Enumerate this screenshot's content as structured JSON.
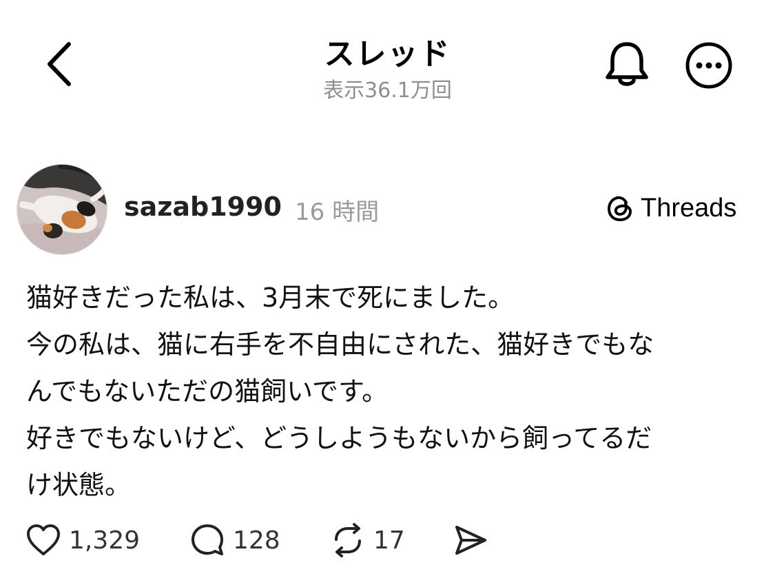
{
  "header": {
    "title": "スレッド",
    "views": "表示36.1万回"
  },
  "post": {
    "username": "sazab1990",
    "time": "16 時間",
    "source_label": "Threads",
    "lines": [
      "猫好きだった私は、3月末で死にました。",
      "今の私は、猫に右手を不自由にされた、猫好きでもな",
      "んでもないただの猫飼いです。",
      "好きでもないけど、どうしようもないから飼ってるだ",
      "け状態。"
    ]
  },
  "actions": {
    "likes": "1,329",
    "replies": "128",
    "reposts": "17"
  },
  "icons": {
    "back": "chevron-left-icon",
    "notifications": "bell-icon",
    "more": "more-horizontal-icon",
    "threads_logo": "threads-logo-icon",
    "like": "heart-icon",
    "reply": "speech-bubble-icon",
    "repost": "repost-icon",
    "share": "send-icon"
  },
  "colors": {
    "text": "#000000",
    "secondary": "#8e8e8e"
  }
}
